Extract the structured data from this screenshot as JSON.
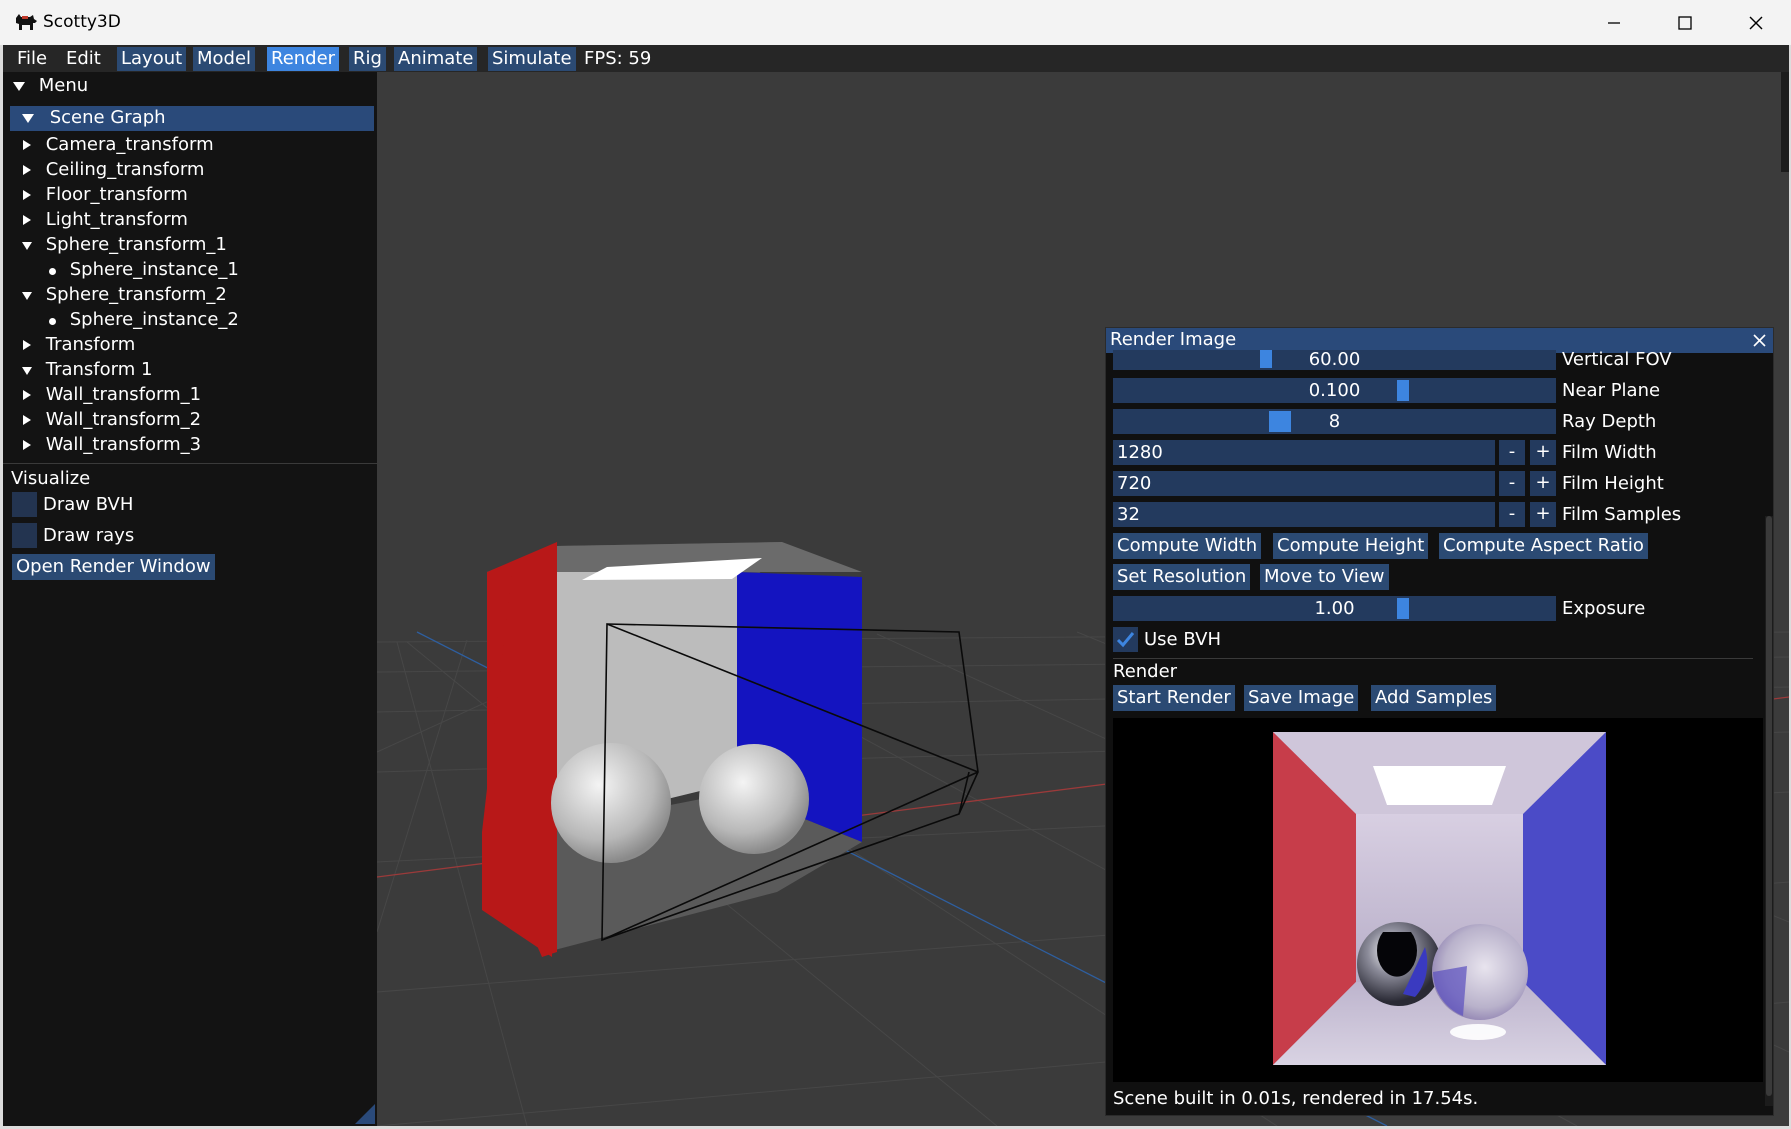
{
  "window": {
    "title": "Scotty3D"
  },
  "menubar": {
    "items": [
      "File",
      "Edit"
    ],
    "modes": [
      "Layout",
      "Model",
      "Render",
      "Rig",
      "Animate",
      "Simulate"
    ],
    "active_mode": "Render",
    "fps": "FPS: 59"
  },
  "left_panel": {
    "menu_header": "Menu",
    "scene_graph": {
      "header": "Scene Graph",
      "items": [
        {
          "label": "Camera_transform",
          "expanded": false
        },
        {
          "label": "Ceiling_transform",
          "expanded": false
        },
        {
          "label": "Floor_transform",
          "expanded": false
        },
        {
          "label": "Light_transform",
          "expanded": false
        },
        {
          "label": "Sphere_transform_1",
          "expanded": true
        },
        {
          "label": "Sphere_instance_1",
          "leaf": true
        },
        {
          "label": "Sphere_transform_2",
          "expanded": true
        },
        {
          "label": "Sphere_instance_2",
          "leaf": true
        },
        {
          "label": "Transform",
          "expanded": false
        },
        {
          "label": "Transform 1",
          "expanded": true
        },
        {
          "label": "Wall_transform_1",
          "expanded": false
        },
        {
          "label": "Wall_transform_2",
          "expanded": false
        },
        {
          "label": "Wall_transform_3",
          "expanded": false
        }
      ]
    },
    "visualize": {
      "header": "Visualize",
      "draw_bvh": "Draw BVH",
      "draw_rays": "Draw rays",
      "open_render_window": "Open Render Window"
    }
  },
  "render_window": {
    "title": "Render Image",
    "vertical_fov": {
      "value": "60.00",
      "label": "Vertical FOV",
      "level": 0.34
    },
    "near_plane": {
      "value": "0.100",
      "label": "Near Plane",
      "level": 0.66
    },
    "ray_depth": {
      "value": "8",
      "label": "Ray Depth",
      "level": 0.37
    },
    "film_width": {
      "value": "1280",
      "label": "Film Width"
    },
    "film_height": {
      "value": "720",
      "label": "Film Height"
    },
    "film_samples": {
      "value": "32",
      "label": "Film Samples"
    },
    "minus": "-",
    "plus": "+",
    "buttons": {
      "compute_width": "Compute Width",
      "compute_height": "Compute Height",
      "compute_aspect": "Compute Aspect Ratio",
      "set_resolution": "Set Resolution",
      "move_to_view": "Move to View"
    },
    "exposure": {
      "value": "1.00",
      "label": "Exposure",
      "level": 0.66
    },
    "use_bvh": {
      "label": "Use BVH",
      "checked": true
    },
    "render_header": "Render",
    "actions": {
      "start_render": "Start Render",
      "save_image": "Save Image",
      "add_samples": "Add Samples"
    },
    "status": "Scene built in 0.01s, rendered in 17.54s."
  },
  "colors": {
    "accent": "#3d85e0",
    "widget": "#233a5e",
    "red_wall": "#b81818",
    "blue_wall": "#1414c0"
  }
}
